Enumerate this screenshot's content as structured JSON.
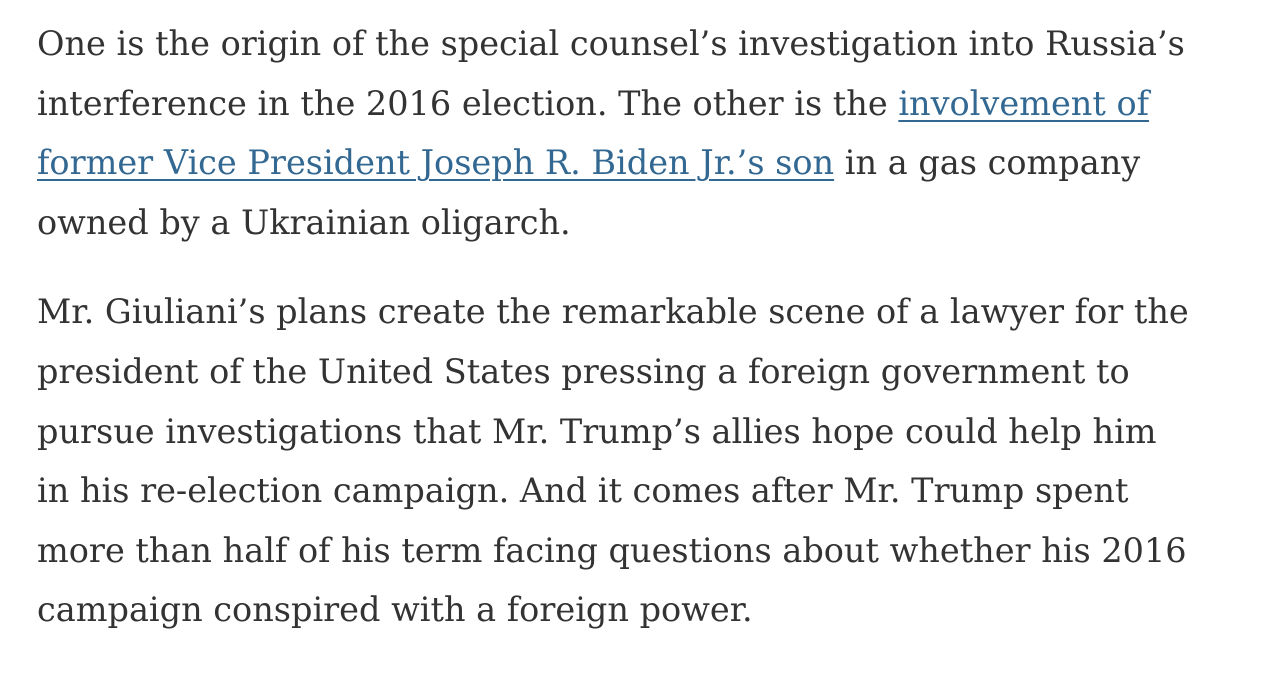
{
  "paragraphs": [
    {
      "lines": [
        "One is the origin of the special counsel’s investigation into Russia’s",
        "interference in the 2016 election. The other is the ",
        " in a gas company",
        "owned by a Ukrainian oligarch."
      ],
      "link": {
        "part1": "involvement of",
        "part2": "former Vice President Joseph R. Biden Jr.’s son"
      }
    },
    {
      "lines": [
        "Mr. Giuliani’s plans create the remarkable scene of a lawyer for the",
        "president of the United States pressing a foreign government to",
        "pursue investigations that Mr. Trump’s allies hope could help him",
        "in his re-election campaign. And it comes after Mr. Trump spent",
        "more than half of his term facing questions about whether his 2016",
        "campaign conspired with a foreign power."
      ]
    }
  ],
  "colors": {
    "text": "#333333",
    "link": "#326891"
  }
}
